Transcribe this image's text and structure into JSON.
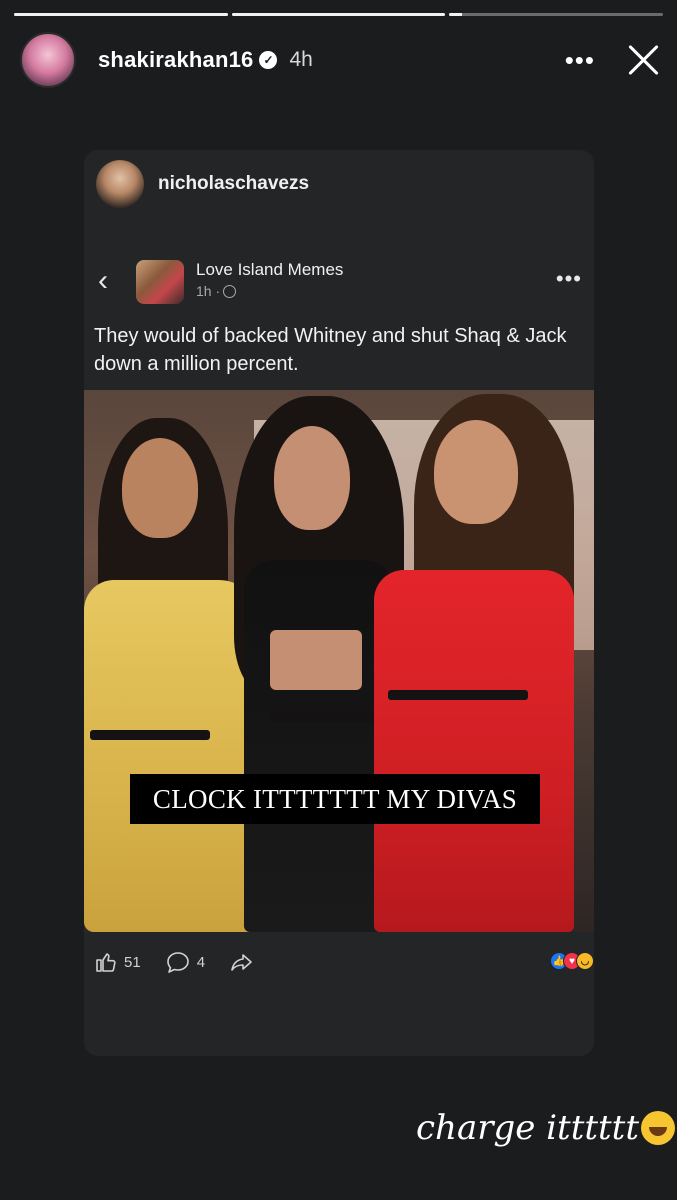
{
  "story": {
    "progress": [
      1.0,
      1.0,
      0.06
    ],
    "username": "shakirakhan16",
    "time": "4h",
    "more_label": "•••"
  },
  "shared_post": {
    "reposter": "nicholaschavezs",
    "group": {
      "name": "Love Island Memes",
      "meta": "1h ·"
    },
    "text": "They would of backed Whitney and shut Shaq & Jack down a million percent.",
    "image_caption": "CLOCK ITTTTTTT MY DIVAS",
    "likes": "51",
    "comments": "4",
    "more_label": "•••"
  },
  "story_caption": "charge itttttt"
}
